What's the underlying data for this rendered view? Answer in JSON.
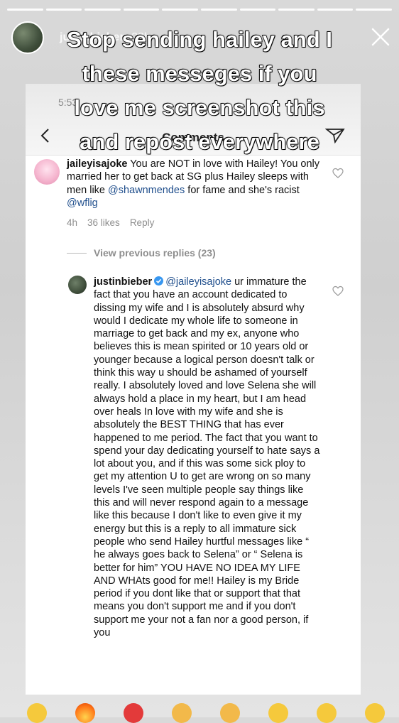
{
  "story": {
    "username": "justinbieber",
    "time": "23h",
    "progress_segments": 10
  },
  "caption": {
    "lines": [
      "Stop sending hailey and I",
      "these messeges if you",
      "love me screenshot this",
      "and repost everywhere"
    ]
  },
  "screenshot": {
    "count": "5:53",
    "title": "Comments",
    "comment1": {
      "user": "jaileyisajoke",
      "text_a": " You are NOT in love with Hailey! You only married her to get back at SG plus Hailey sleeps with men like ",
      "mention1": "@shawnmendes",
      "text_b": " for fame and she's racist ",
      "mention2": "@wflig",
      "time": "4h",
      "likes": "36 likes",
      "reply": "Reply"
    },
    "view_replies": "View previous replies (23)",
    "comment2": {
      "user": "justinbieber",
      "mention": "@jaileyisajoke",
      "text": " ur immature the fact that you have an account dedicated to dissing my wife and I is absolutely absurd why would I dedicate my whole life to someone in marriage to get back and my ex, anyone who believes this is mean spirited or 10 years old or younger because a logical person doesn't talk or think this way u should be ashamed of yourself really.  I absolutely loved and love Selena she will always hold a place in my heart, but I am head over heals In love with my wife and she is absolutely the BEST THING that has ever happened to me period. The fact that you want to spend your day dedicating yourself to hate says a lot about you, and if this was some sick ploy to get my attention U to get are wrong on so many levels I've seen multiple people say things like this and will never respond again to a message like this because I don't like to even give it my energy but this is a reply to all immature sick people who send Hailey hurtful messages like “ he always goes back to Selena” or “ Selena is better for him” YOU HAVE NO IDEA MY LIFE AND WHAts good for me!! Hailey is my Bride period if you dont like that or support that that means you don't support me and if you don't support me your not a fan nor a good person, if you"
    }
  },
  "reactions": [
    "grinning-face",
    "fire",
    "red-heart",
    "raising-hands",
    "clapping-hands",
    "crying-laughing",
    "heart-eyes",
    "smiling-face"
  ]
}
